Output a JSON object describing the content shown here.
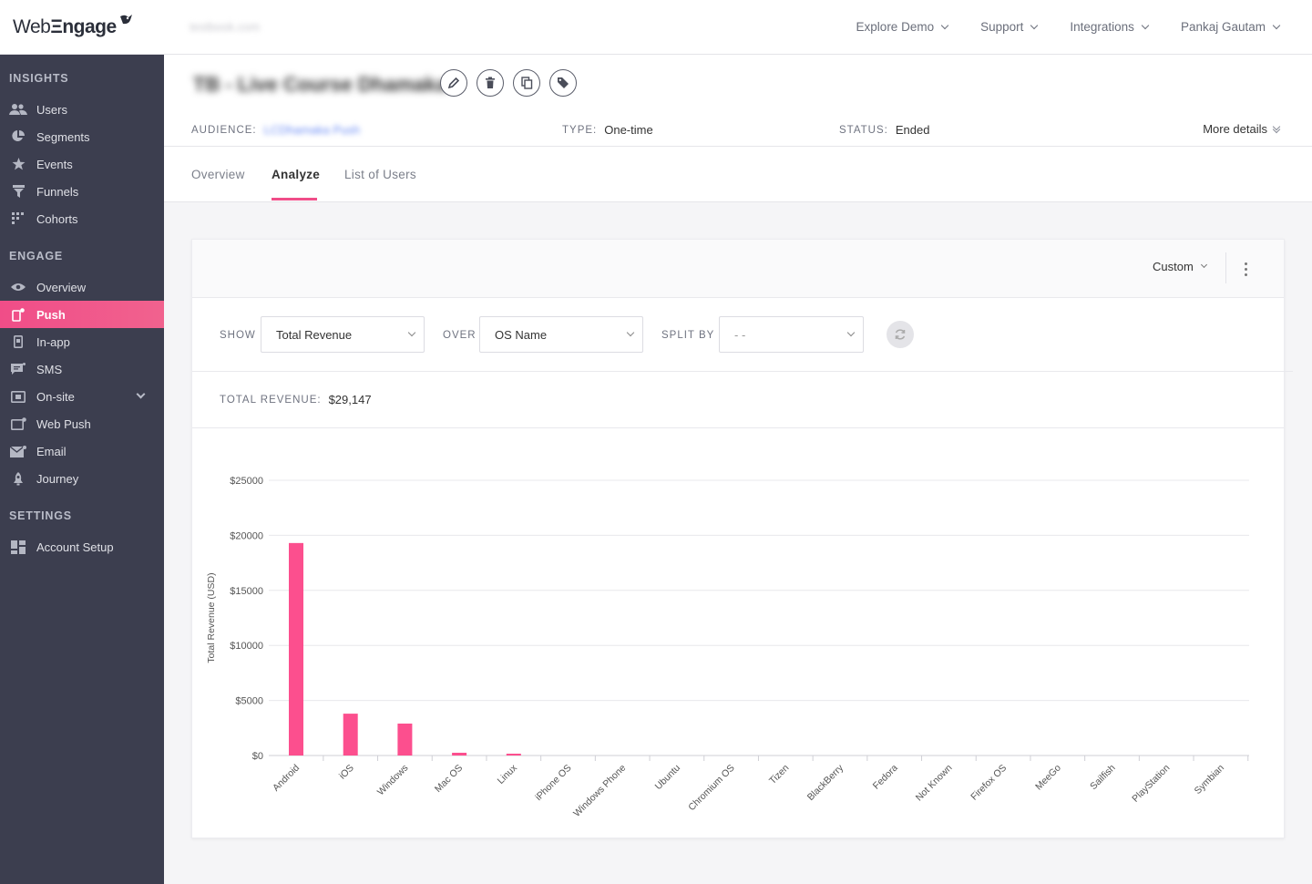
{
  "app": {
    "logo": {
      "part1": "Web",
      "part2": "ngage"
    },
    "account": "testbook.com",
    "nav": [
      "Explore Demo",
      "Support",
      "Integrations",
      "Pankaj Gautam"
    ]
  },
  "sidebar": {
    "sections": [
      {
        "title": "INSIGHTS",
        "items": [
          {
            "label": "Users",
            "icon": "users-icon"
          },
          {
            "label": "Segments",
            "icon": "segments-icon"
          },
          {
            "label": "Events",
            "icon": "events-icon"
          },
          {
            "label": "Funnels",
            "icon": "funnels-icon"
          },
          {
            "label": "Cohorts",
            "icon": "cohorts-icon"
          }
        ]
      },
      {
        "title": "ENGAGE",
        "items": [
          {
            "label": "Overview",
            "icon": "eye-icon"
          },
          {
            "label": "Push",
            "icon": "push-icon",
            "active": true
          },
          {
            "label": "In-app",
            "icon": "in-app-icon"
          },
          {
            "label": "SMS",
            "icon": "sms-icon"
          },
          {
            "label": "On-site",
            "icon": "on-site-icon",
            "expandable": true
          },
          {
            "label": "Web Push",
            "icon": "web-push-icon"
          },
          {
            "label": "Email",
            "icon": "email-icon"
          },
          {
            "label": "Journey",
            "icon": "journey-icon"
          }
        ]
      },
      {
        "title": "SETTINGS",
        "items": [
          {
            "label": "Account Setup",
            "icon": "dashboard-icon"
          }
        ]
      }
    ]
  },
  "campaign": {
    "title": "TB - Live Course Dhamaka",
    "actions": [
      "edit-icon",
      "delete-icon",
      "copy-icon",
      "tag-icon"
    ],
    "audience_label": "AUDIENCE:",
    "audience_value": "LCDhamaka Push",
    "type_label": "TYPE:",
    "type_value": "One-time",
    "status_label": "STATUS:",
    "status_value": "Ended",
    "more_details": "More details"
  },
  "tabs": [
    {
      "label": "Overview"
    },
    {
      "label": "Analyze",
      "active": true
    },
    {
      "label": "List of Users"
    }
  ],
  "card": {
    "range": "Custom",
    "filters": {
      "show_label": "SHOW",
      "show_value": "Total Revenue",
      "over_label": "OVER",
      "over_value": "OS Name",
      "split_label": "SPLIT BY",
      "split_value": "- -"
    },
    "total_label": "TOTAL REVENUE:",
    "total_value": "$29,147"
  },
  "colors": {
    "accent": "#f04d88",
    "sidebar": "#3c3e4f",
    "bar": "#fc4f8e"
  },
  "chart_data": {
    "type": "bar",
    "ylabel": "Total Revenue (USD)",
    "xlabel": "",
    "ylim": [
      0,
      25000
    ],
    "yticks": [
      "$0",
      "$5000",
      "$10000",
      "$15000",
      "$20000",
      "$25000"
    ],
    "ytick_values": [
      0,
      5000,
      10000,
      15000,
      20000,
      25000
    ],
    "grid": true,
    "categories": [
      "Android",
      "iOS",
      "Windows",
      "Mac OS",
      "Linux",
      "iPhone OS",
      "Windows Phone",
      "Ubuntu",
      "Chromium OS",
      "Tizen",
      "BlackBerry",
      "Fedora",
      "Not Known",
      "Firefox OS",
      "MeeGo",
      "Sailfish",
      "PlayStation",
      "Symbian"
    ],
    "values": [
      19300,
      3800,
      2900,
      250,
      150,
      0,
      0,
      0,
      0,
      0,
      0,
      0,
      0,
      0,
      0,
      0,
      0,
      0
    ]
  }
}
